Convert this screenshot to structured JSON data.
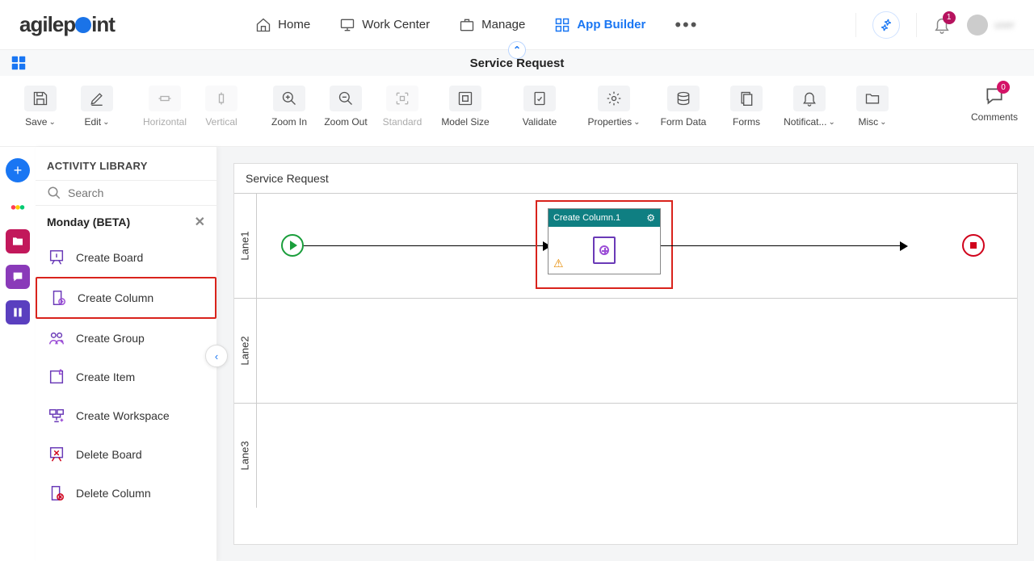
{
  "nav": {
    "logo": "agilepoint",
    "items": [
      {
        "label": "Home",
        "active": false
      },
      {
        "label": "Work Center",
        "active": false
      },
      {
        "label": "Manage",
        "active": false
      },
      {
        "label": "App Builder",
        "active": true
      }
    ],
    "notif_count": "1",
    "username": "user"
  },
  "subheader": {
    "title": "Service Request"
  },
  "toolbar": {
    "save": "Save",
    "edit": "Edit",
    "horizontal": "Horizontal",
    "vertical": "Vertical",
    "zoom_in": "Zoom In",
    "zoom_out": "Zoom Out",
    "standard": "Standard",
    "model_size": "Model Size",
    "validate": "Validate",
    "properties": "Properties",
    "form_data": "Form Data",
    "forms": "Forms",
    "notifications": "Notificat...",
    "misc": "Misc",
    "comments": "Comments",
    "comments_count": "0"
  },
  "sidebar": {
    "title": "ACTIVITY LIBRARY",
    "search_placeholder": "Search",
    "category": "Monday (BETA)",
    "items": [
      {
        "label": "Create Board"
      },
      {
        "label": "Create Column"
      },
      {
        "label": "Create Group"
      },
      {
        "label": "Create Item"
      },
      {
        "label": "Create Workspace"
      },
      {
        "label": "Delete Board"
      },
      {
        "label": "Delete Column"
      }
    ]
  },
  "canvas": {
    "title": "Service Request",
    "lanes": [
      "Lane1",
      "Lane2",
      "Lane3"
    ],
    "activity": {
      "title": "Create Column.1"
    }
  }
}
